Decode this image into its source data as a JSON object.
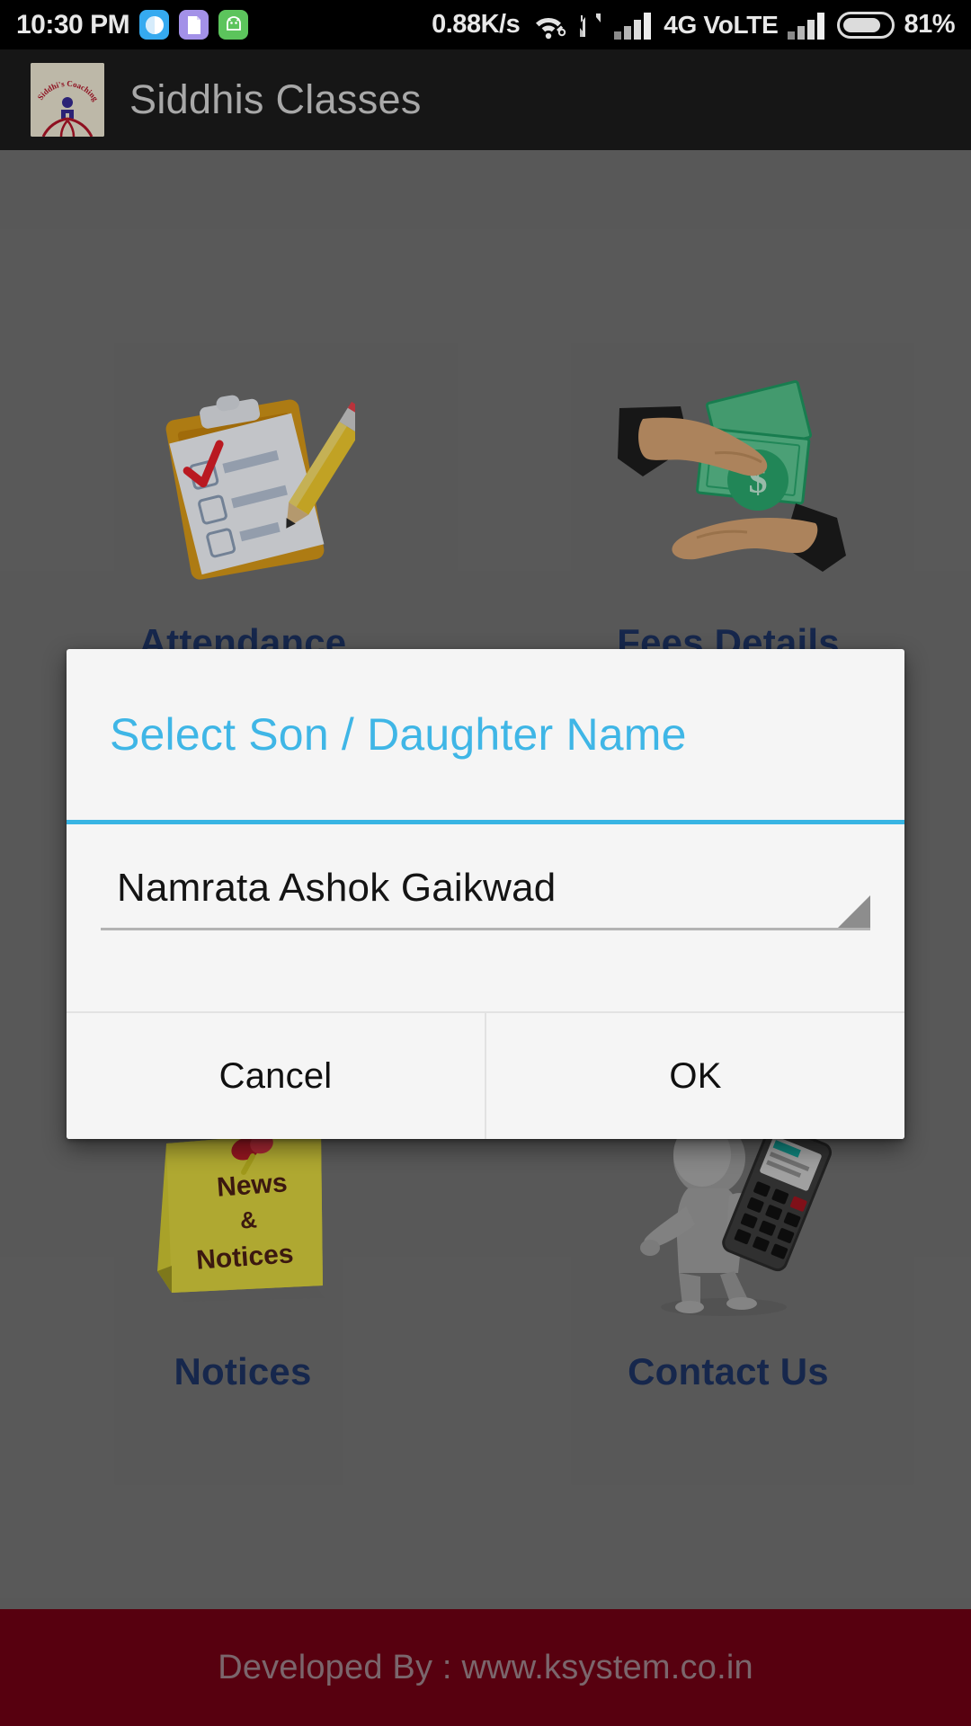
{
  "status_bar": {
    "time": "10:30 PM",
    "net_speed": "0.88K/s",
    "network_label": "4G  VoLTE",
    "battery_percent": "81%",
    "battery_level": 81,
    "icons": [
      "messenger-notification-icon",
      "document-notification-icon",
      "android-notification-icon",
      "wifi-icon",
      "data-transfer-icon",
      "signal-bars-icon",
      "signal-bars-2-icon",
      "battery-icon"
    ]
  },
  "app_bar": {
    "title": "Siddhis Classes",
    "logo_text": "Siddhi's Coaching Classes",
    "logo_name": "siddhis-coaching-classes-logo"
  },
  "home": {
    "tiles": [
      {
        "label": "Attendance",
        "icon": "clipboard-checklist-pencil-icon"
      },
      {
        "label": "Fees Details",
        "icon": "hands-exchanging-money-icon"
      },
      {
        "label": "Notices",
        "icon": "sticky-note-news-notices-icon",
        "note_line1": "News",
        "note_line2": "&",
        "note_line3": "Notices"
      },
      {
        "label": "Contact Us",
        "icon": "person-holding-phone-icon"
      }
    ]
  },
  "dialog": {
    "title": "Select Son / Daughter Name",
    "spinner": {
      "name": "student-name-spinner",
      "selected_value": "Namrata Ashok Gaikwad"
    },
    "cancel_label": "Cancel",
    "ok_label": "OK"
  },
  "footer": {
    "text": "Developed By :   www.ksystem.co.in"
  },
  "colors": {
    "accent_blue": "#38b4e3",
    "title_blue": "#3fb6e6",
    "tile_label_navy": "#1c3160",
    "footer_maroon": "#6d0013",
    "app_bar_black": "#161616",
    "dialog_bg": "#f5f5f5",
    "page_bg": "#6f6f6f"
  }
}
